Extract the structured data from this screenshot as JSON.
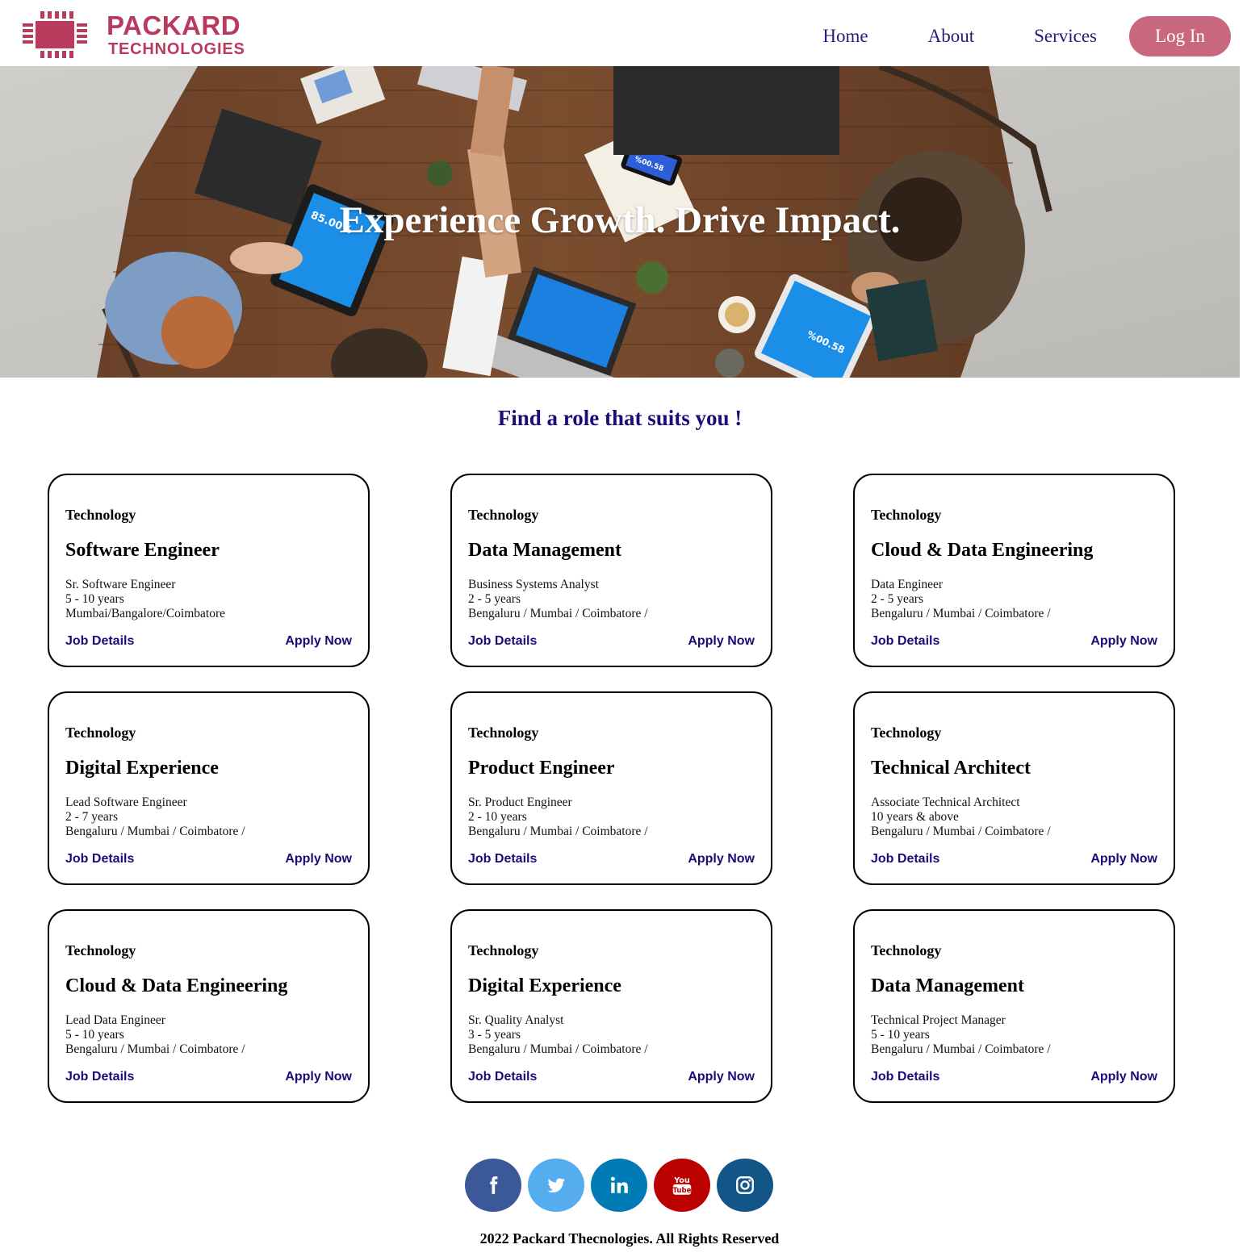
{
  "brand": {
    "name_line1": "PACKARD",
    "name_line2": "TECHNOLOGIES",
    "color": "#b83a5c"
  },
  "nav": {
    "items": [
      {
        "label": "Home"
      },
      {
        "label": "About"
      },
      {
        "label": "Services"
      }
    ],
    "login_label": "Log In",
    "link_color": "#2a1a7a",
    "login_color": "#c9677f"
  },
  "hero": {
    "title": "Experience Growth. Drive Impact.",
    "tablet_left_text": "85.00%",
    "tablet_right_text": "%00.58",
    "phone_text": "%00.58"
  },
  "section": {
    "title": "Find a role that suits you !"
  },
  "jobs": [
    {
      "category": "Technology",
      "title": "Software Engineer",
      "role": "Sr. Software Engineer",
      "experience": "5 - 10 years",
      "location": "Mumbai/Bangalore/Coimbatore",
      "details_label": "Job Details",
      "apply_label": "Apply Now"
    },
    {
      "category": "Technology",
      "title": "Data Management",
      "role": "Business Systems Analyst",
      "experience": "2 - 5 years",
      "location": "Bengaluru / Mumbai / Coimbatore /",
      "details_label": "Job Details",
      "apply_label": "Apply Now"
    },
    {
      "category": "Technology",
      "title": "Cloud & Data Engineering",
      "role": "Data Engineer",
      "experience": "2 - 5 years",
      "location": "Bengaluru / Mumbai / Coimbatore /",
      "details_label": "Job Details",
      "apply_label": "Apply Now"
    },
    {
      "category": "Technology",
      "title": "Digital Experience",
      "role": "Lead Software Engineer",
      "experience": "2 - 7 years",
      "location": "Bengaluru / Mumbai / Coimbatore /",
      "details_label": "Job Details",
      "apply_label": "Apply Now"
    },
    {
      "category": "Technology",
      "title": "Product Engineer",
      "role": "Sr. Product Engineer",
      "experience": "2 - 10 years",
      "location": "Bengaluru / Mumbai / Coimbatore /",
      "details_label": "Job Details",
      "apply_label": "Apply Now"
    },
    {
      "category": "Technology",
      "title": "Technical Architect",
      "role": "Associate Technical Architect",
      "experience": "10 years & above",
      "location": "Bengaluru / Mumbai / Coimbatore /",
      "details_label": "Job Details",
      "apply_label": "Apply Now"
    },
    {
      "category": "Technology",
      "title": "Cloud & Data Engineering",
      "role": "Lead Data Engineer",
      "experience": "5 - 10 years",
      "location": "Bengaluru / Mumbai / Coimbatore /",
      "details_label": "Job Details",
      "apply_label": "Apply Now"
    },
    {
      "category": "Technology",
      "title": "Digital Experience",
      "role": "Sr. Quality Analyst",
      "experience": "3 - 5 years",
      "location": "Bengaluru / Mumbai / Coimbatore /",
      "details_label": "Job Details",
      "apply_label": "Apply Now"
    },
    {
      "category": "Technology",
      "title": "Data Management",
      "role": "Technical Project Manager",
      "experience": "5 - 10 years",
      "location": "Bengaluru / Mumbai / Coimbatore /",
      "details_label": "Job Details",
      "apply_label": "Apply Now"
    }
  ],
  "social": [
    {
      "icon": "facebook-icon",
      "color": "#3b5998"
    },
    {
      "icon": "twitter-icon",
      "color": "#55acee"
    },
    {
      "icon": "linkedin-icon",
      "color": "#007bb5"
    },
    {
      "icon": "youtube-icon",
      "color": "#bb0000"
    },
    {
      "icon": "instagram-icon",
      "color": "#125688"
    }
  ],
  "footer": {
    "text": "2022 Packard Thecnologies. All Rights Reserved"
  }
}
